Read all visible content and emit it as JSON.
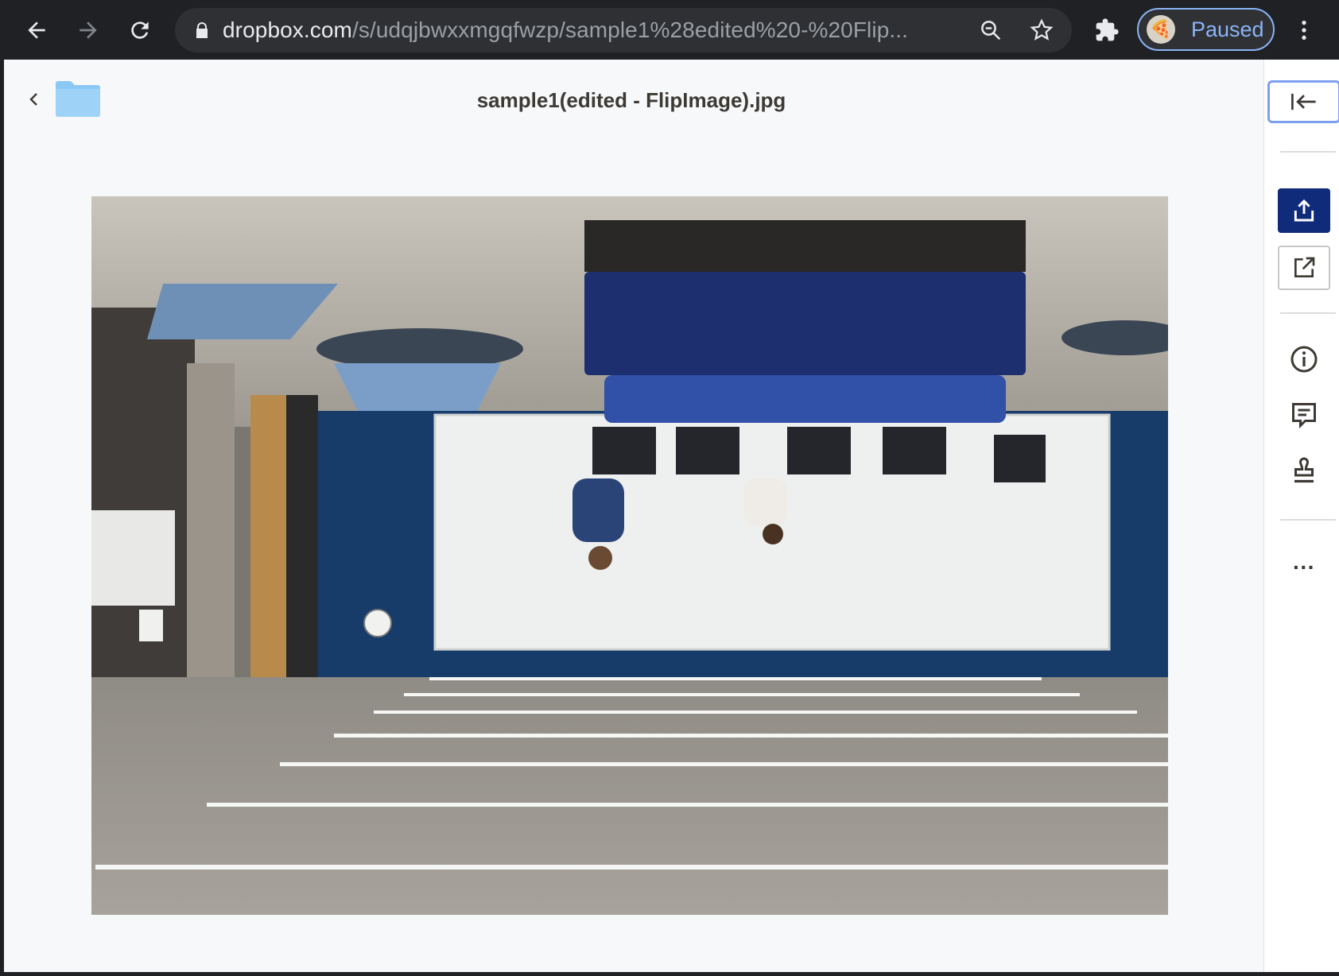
{
  "browser": {
    "url_host": "dropbox.com",
    "url_path": "/s/udqjbwxxmgqfwzp/sample1%28edited%20-%20Flip...",
    "profile_status": "Paused"
  },
  "viewer": {
    "file_title": "sample1(edited - FlipImage).jpg",
    "preview_alt": "Upside-down photo of an office room with a whiteboard, blue sofas and tables"
  },
  "side_panel": {
    "more_label": "···"
  },
  "colors": {
    "share_button": "#0f2b7a",
    "focus_ring": "#7d9ff0",
    "folder": "#8cc8f5"
  }
}
